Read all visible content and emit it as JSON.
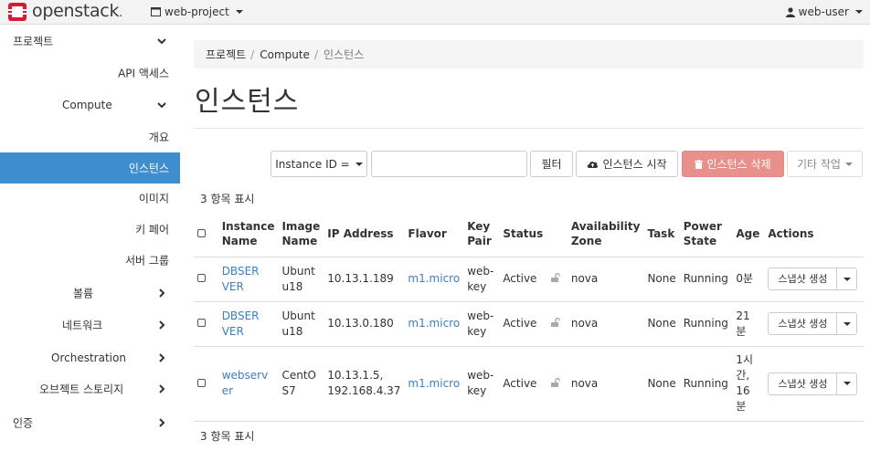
{
  "brand": {
    "name": "openstack",
    "dot": "."
  },
  "header": {
    "project_label": "web-project",
    "user_label": "web-user"
  },
  "sidebar": {
    "items": [
      {
        "label": "프로젝트"
      },
      {
        "label": "API 액세스"
      },
      {
        "label": "Compute"
      },
      {
        "label": "개요"
      },
      {
        "label": "인스턴스"
      },
      {
        "label": "이미지"
      },
      {
        "label": "키 페어"
      },
      {
        "label": "서버 그룹"
      },
      {
        "label": "볼륨"
      },
      {
        "label": "네트워크"
      },
      {
        "label": "Orchestration"
      },
      {
        "label": "오브젝트 스토리지"
      },
      {
        "label": "인증"
      }
    ]
  },
  "breadcrumb": {
    "items": [
      "프로젝트",
      "Compute",
      "인스턴스"
    ],
    "sep": "/"
  },
  "page_title": "인스턴스",
  "toolbar": {
    "filter_select": "Instance ID =",
    "filter_value": "",
    "filter_btn": "필터",
    "launch_btn": "인스턴스 시작",
    "delete_btn": "인스턴스 삭제",
    "more_btn": "기타 작업"
  },
  "count_top": "3 항목 표시",
  "count_bottom": "3 항목 표시",
  "table": {
    "headers": {
      "name": [
        "Instance",
        "Name"
      ],
      "image": [
        "Image",
        "Name"
      ],
      "ip": "IP Address",
      "flavor": "Flavor",
      "keypair": [
        "Key",
        "Pair"
      ],
      "status": "Status",
      "zone": [
        "Availability",
        "Zone"
      ],
      "task": "Task",
      "power": [
        "Power",
        "State"
      ],
      "age": "Age",
      "actions": "Actions"
    },
    "rows": [
      {
        "name": [
          "DBSER",
          "VER"
        ],
        "image": [
          "Ubunt",
          "u18"
        ],
        "ip": [
          "10.13.1.189"
        ],
        "flavor": "m1.micro",
        "keypair": [
          "web-",
          "key"
        ],
        "status": "Active",
        "zone": "nova",
        "task": "None",
        "power": "Running",
        "age": [
          "0분"
        ],
        "action": "스냅샷 생성"
      },
      {
        "name": [
          "DBSER",
          "VER"
        ],
        "image": [
          "Ubunt",
          "u18"
        ],
        "ip": [
          "10.13.0.180"
        ],
        "flavor": "m1.micro",
        "keypair": [
          "web-",
          "key"
        ],
        "status": "Active",
        "zone": "nova",
        "task": "None",
        "power": "Running",
        "age": [
          "21",
          "분"
        ],
        "action": "스냅샷 생성"
      },
      {
        "name": [
          "webserv",
          "er"
        ],
        "image": [
          "CentO",
          "S7"
        ],
        "ip": [
          "10.13.1.5,",
          "192.168.4.37"
        ],
        "flavor": "m1.micro",
        "keypair": [
          "web-",
          "key"
        ],
        "status": "Active",
        "zone": "nova",
        "task": "None",
        "power": "Running",
        "age": [
          "1시",
          "간,",
          "16",
          "분"
        ],
        "action": "스냅샷 생성"
      }
    ]
  },
  "colors": {
    "active_nav": "#3e8ecf",
    "link": "#3b7fc0",
    "danger": "#e7908c",
    "logo_red": "#da1a32"
  }
}
